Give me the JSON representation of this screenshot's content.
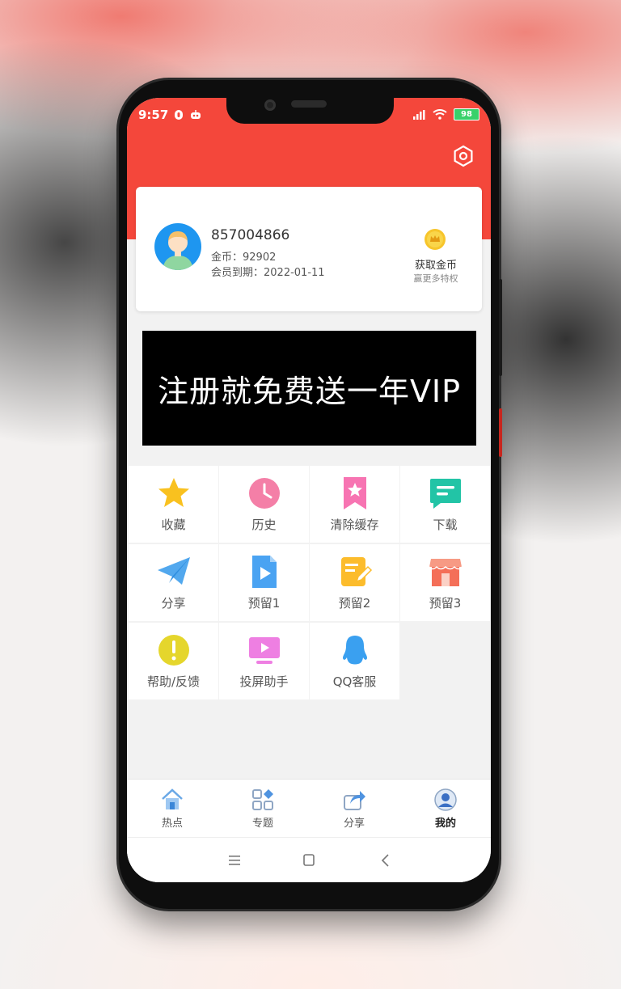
{
  "status_bar": {
    "time": "9:57",
    "battery": "98"
  },
  "profile": {
    "username": "857004866",
    "coins_text": "金币：92902",
    "membership_text": "会员到期：2022-01-11",
    "get_coins_label": "获取金币",
    "more_privileges_label": "赢更多特权"
  },
  "banner": {
    "text": "注册就免费送一年VIP"
  },
  "grid": [
    {
      "label": "收藏",
      "icon": "star-icon"
    },
    {
      "label": "历史",
      "icon": "clock-icon"
    },
    {
      "label": "清除缓存",
      "icon": "bookmark-icon"
    },
    {
      "label": "下载",
      "icon": "message-icon"
    },
    {
      "label": "分享",
      "icon": "paper-plane-icon"
    },
    {
      "label": "预留1",
      "icon": "video-file-icon"
    },
    {
      "label": "预留2",
      "icon": "edit-note-icon"
    },
    {
      "label": "预留3",
      "icon": "store-icon"
    },
    {
      "label": "帮助/反馈",
      "icon": "exclamation-icon"
    },
    {
      "label": "投屏助手",
      "icon": "cast-screen-icon"
    },
    {
      "label": "QQ客服",
      "icon": "qq-penguin-icon"
    }
  ],
  "tabs": [
    {
      "label": "热点",
      "icon": "home-icon"
    },
    {
      "label": "专题",
      "icon": "grid-icon"
    },
    {
      "label": "分享",
      "icon": "share-icon"
    },
    {
      "label": "我的",
      "icon": "user-icon",
      "active": true
    }
  ],
  "colors": {
    "accent": "#f4473b",
    "background": "#f2f2f2"
  }
}
